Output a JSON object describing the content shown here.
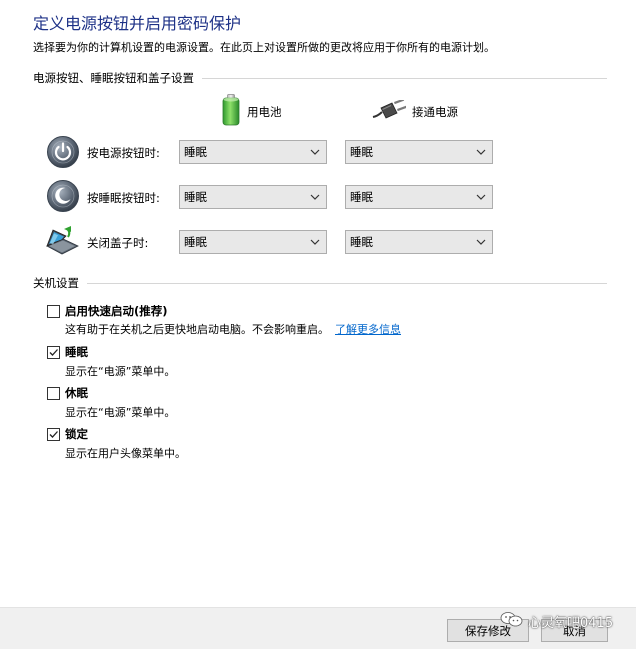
{
  "page": {
    "title": "定义电源按钮并启用密码保护",
    "description": "选择要为你的计算机设置的电源设置。在此页上对设置所做的更改将应用于你所有的电源计划。"
  },
  "power_section": {
    "header": "电源按钮、睡眠按钮和盖子设置",
    "columns": {
      "battery": {
        "label": "用电池",
        "icon": "battery-icon"
      },
      "plugged_in": {
        "label": "接通电源",
        "icon": "power-plug-icon"
      }
    },
    "rows": [
      {
        "label": "按电源按钮时:",
        "icon": "power-button-icon",
        "battery": "睡眠",
        "plugged_in": "睡眠"
      },
      {
        "label": "按睡眠按钮时:",
        "icon": "sleep-button-icon",
        "battery": "睡眠",
        "plugged_in": "睡眠"
      },
      {
        "label": "关闭盖子时:",
        "icon": "laptop-lid-icon",
        "battery": "睡眠",
        "plugged_in": "睡眠"
      }
    ]
  },
  "shutdown_section": {
    "header": "关机设置",
    "options": [
      {
        "label": "启用快速启动(推荐)",
        "checked": false,
        "description": "这有助于在关机之后更快地启动电脑。不会影响重启。",
        "link": "了解更多信息"
      },
      {
        "label": "睡眠",
        "checked": true,
        "description": "显示在“电源”菜单中。"
      },
      {
        "label": "休眠",
        "checked": false,
        "description": "显示在“电源”菜单中。"
      },
      {
        "label": "锁定",
        "checked": true,
        "description": "显示在用户头像菜单中。"
      }
    ]
  },
  "footer": {
    "save_label": "保存修改",
    "cancel_label": "取消"
  },
  "watermark": {
    "text": "心灵氧吧0415"
  },
  "colors": {
    "title": "#1e3287",
    "link": "#0066cc",
    "footer_bg": "#f0f0f0"
  }
}
